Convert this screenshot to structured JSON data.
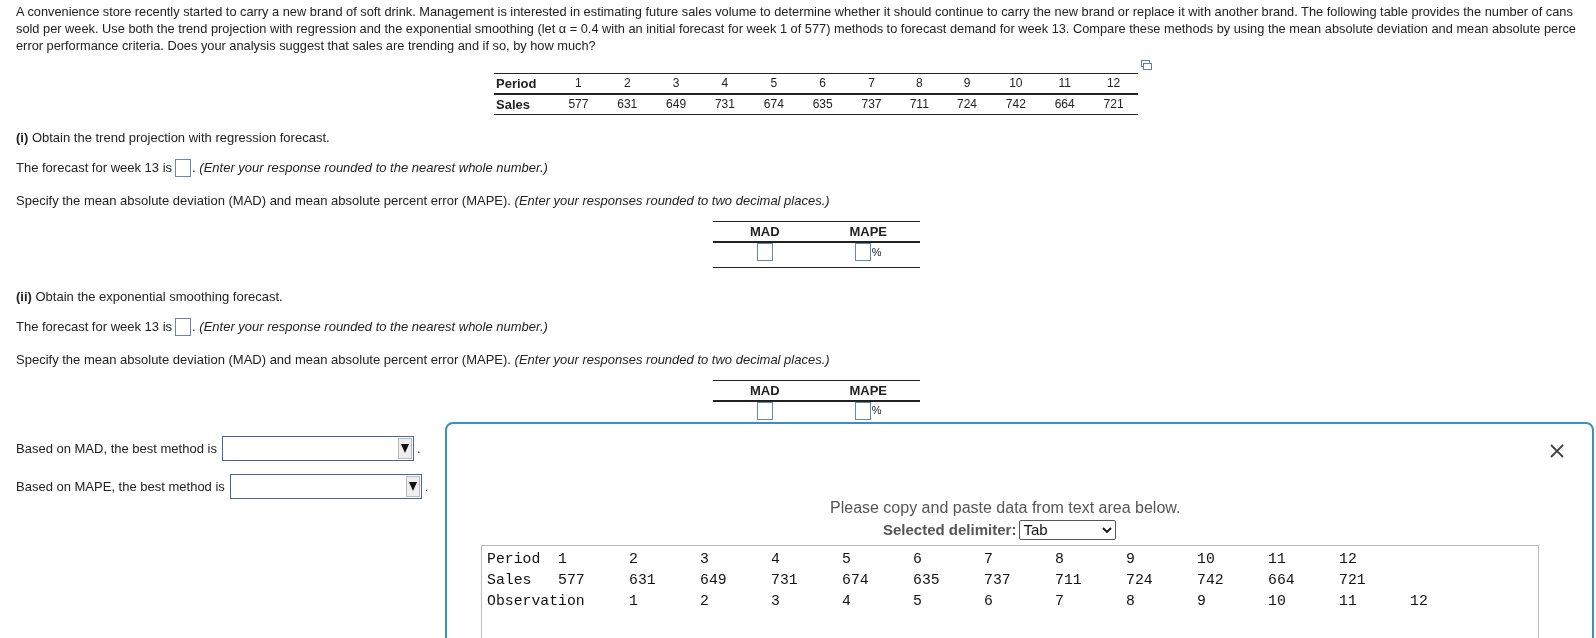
{
  "problem": {
    "lines": [
      "A convenience store recently started to carry a new brand of soft drink. Management is interested in estimating future sales volume to determine whether it should continue to carry the new brand or replace it with another brand. The following table provides the number of cans",
      "sold per week. Use both the trend projection with regression and the exponential smoothing (let α = 0.4 with an initial forecast for week 1 of 577) methods to forecast demand for week 13. Compare these methods by using the mean absolute deviation and mean absolute perce",
      "error performance criteria. Does your analysis suggest that sales are trending and if so, by how much?"
    ]
  },
  "data_table": {
    "rows": [
      {
        "header": "Period",
        "cells": [
          "1",
          "2",
          "3",
          "4",
          "5",
          "6",
          "7",
          "8",
          "9",
          "10",
          "11",
          "12"
        ]
      },
      {
        "header": "Sales",
        "cells": [
          "577",
          "631",
          "649",
          "731",
          "674",
          "635",
          "737",
          "711",
          "724",
          "742",
          "664",
          "721"
        ]
      }
    ]
  },
  "parts": [
    {
      "heading": "**(i)** Obtain the trend projection with regression forecast.",
      "forecast_prompt": "The forecast for week 13 is",
      "forecast_hint": ". *(Enter your response rounded to the nearest whole number.)*",
      "error_prompt": "Specify the mean absolute deviation (MAD) and mean absolute percent error (MAPE). *(Enter your responses rounded to two decimal places.)*",
      "columns": [
        "MAD",
        "MAPE"
      ],
      "percent_sign": "%"
    },
    {
      "heading": "**(ii)** Obtain the exponential smoothing forecast.",
      "forecast_prompt": "The forecast for week 13 is",
      "forecast_hint": ". *(Enter your response rounded to the nearest whole number.)*",
      "error_prompt": "Specify the mean absolute deviation (MAD) and mean absolute percent error (MAPE). *(Enter your responses rounded to two decimal places.)*",
      "columns": [
        "MAD",
        "MAPE"
      ],
      "percent_sign": "%"
    }
  ],
  "choices": [
    {
      "label": "Based on MAD, the best method is",
      "suffix": "."
    },
    {
      "label": "Based on MAPE, the best method is",
      "suffix": "."
    }
  ],
  "dialog": {
    "instruction": "Please copy and paste data from text area below.",
    "delimiter_label": "Selected delimiter:",
    "delimiter_value": "Tab",
    "text_rows": [
      [
        "Period",
        "1",
        "2",
        "3",
        "4",
        "5",
        "6",
        "7",
        "8",
        "9",
        "10",
        "11",
        "12"
      ],
      [
        "Sales",
        "577",
        "631",
        "649",
        "731",
        "674",
        "635",
        "737",
        "711",
        "724",
        "742",
        "664",
        "721"
      ],
      [
        "Observation",
        "1",
        "2",
        "3",
        "4",
        "5",
        "6",
        "7",
        "8",
        "9",
        "10",
        "11",
        "12"
      ]
    ]
  }
}
